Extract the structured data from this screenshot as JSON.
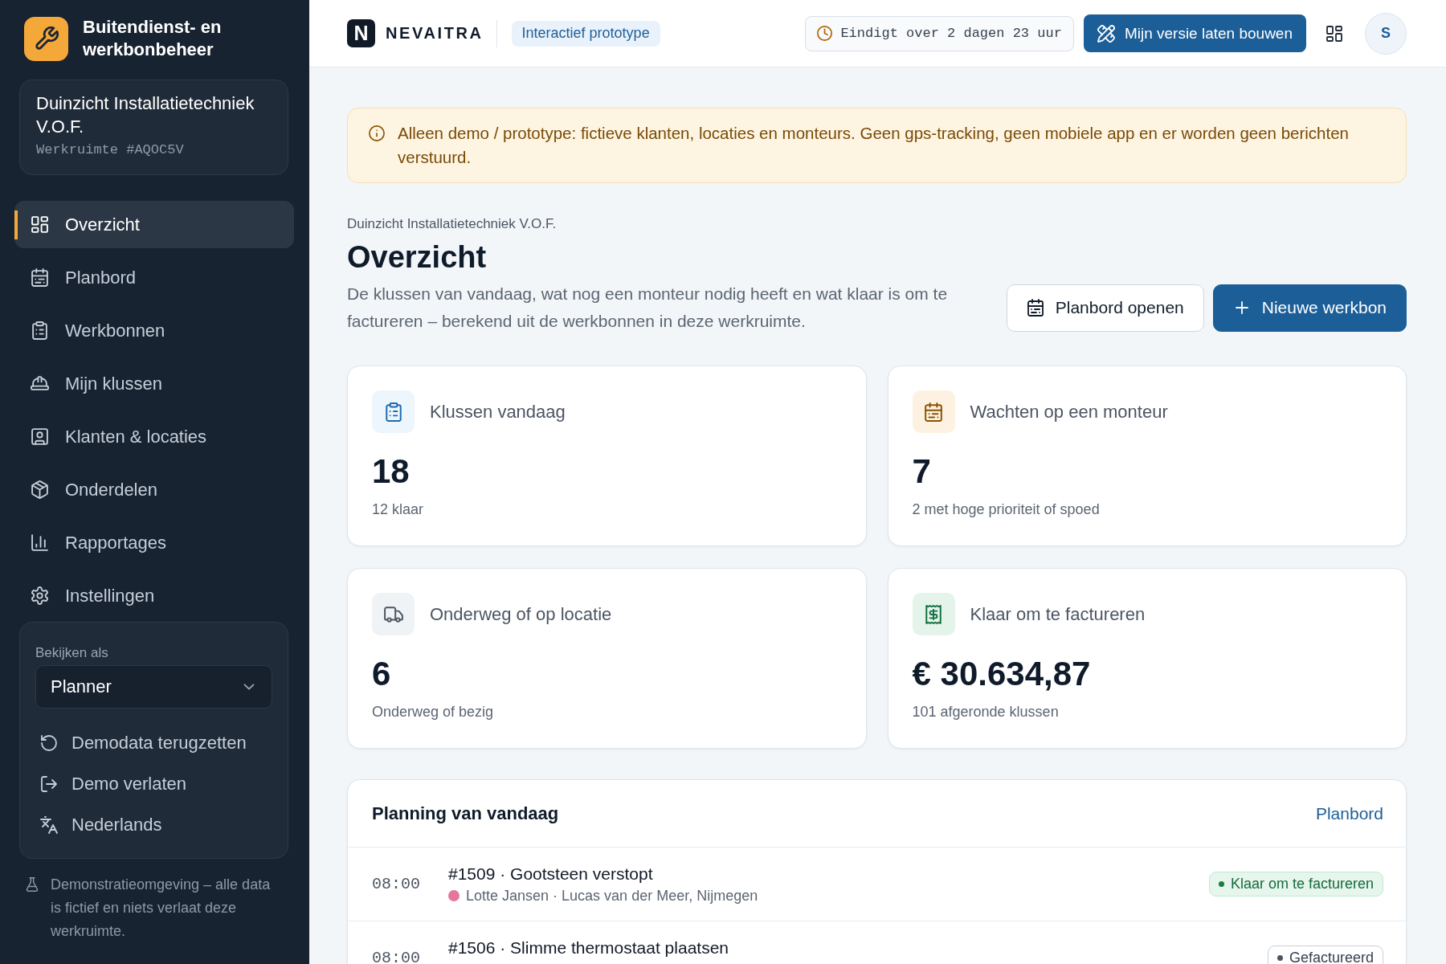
{
  "sidebar": {
    "app_title": "Buitendienst- en werkbonbeheer",
    "workspace": {
      "name": "Duinzicht Installatietechniek V.O.F.",
      "id_label": "Werkruimte #AQOC5V"
    },
    "nav": [
      {
        "label": "Overzicht",
        "kind": "overview",
        "selected": true
      },
      {
        "label": "Planbord",
        "kind": "planning",
        "selected": false
      },
      {
        "label": "Werkbonnen",
        "kind": "workorders",
        "selected": false
      },
      {
        "label": "Mijn klussen",
        "kind": "myjobs",
        "selected": false
      },
      {
        "label": "Klanten & locaties",
        "kind": "customers",
        "selected": false
      },
      {
        "label": "Onderdelen",
        "kind": "parts",
        "selected": false
      },
      {
        "label": "Rapportages",
        "kind": "reports",
        "selected": false
      },
      {
        "label": "Instellingen",
        "kind": "settings",
        "selected": false
      }
    ],
    "view_as": {
      "label": "Bekijken als",
      "value": "Planner"
    },
    "actions": [
      {
        "label": "Demodata terugzetten",
        "kind": "reset"
      },
      {
        "label": "Demo verlaten",
        "kind": "exit"
      },
      {
        "label": "Nederlands",
        "kind": "language"
      }
    ],
    "footer_note": "Demonstratieomgeving – alle data is fictief en niets verlaat deze werkruimte."
  },
  "header": {
    "brand": {
      "mark": "N",
      "name": "NEVAITRA"
    },
    "badge": "Interactief prototype",
    "countdown": "Eindigt over 2 dagen 23 uur",
    "build_button": "Mijn versie laten bouwen",
    "avatar": "S"
  },
  "alert": "Alleen demo / prototype: fictieve klanten, locaties en monteurs. Geen gps-tracking, geen mobiele app en er worden geen berichten verstuurd.",
  "page": {
    "breadcrumb": "Duinzicht Installatietechniek V.O.F.",
    "title": "Overzicht",
    "description": "De klussen van vandaag, wat nog een monteur nodig heeft en wat klaar is om te factureren – berekend uit de werkbonnen in deze werkruimte.",
    "buttons": [
      {
        "label": "Planbord openen",
        "kind": "secondary"
      },
      {
        "label": "Nieuwe werkbon",
        "kind": "primary"
      }
    ]
  },
  "stats": [
    {
      "kind": "jobs",
      "label": "Klussen vandaag",
      "value": "18",
      "note": "12 klaar"
    },
    {
      "kind": "waiting",
      "label": "Wachten op een monteur",
      "value": "7",
      "note": "2 met hoge prioriteit of spoed"
    },
    {
      "kind": "onroute",
      "label": "Onderweg of op locatie",
      "value": "6",
      "note": "Onderweg of bezig"
    },
    {
      "kind": "billing",
      "label": "Klaar om te factureren",
      "value": "€ 30.634,87",
      "note": "101 afgeronde klussen"
    }
  ],
  "planning": {
    "title": "Planning van vandaag",
    "link": "Planbord",
    "rows": [
      {
        "time": "08:00",
        "title": "#1509 · Gootsteen verstopt",
        "color": "#e5779d",
        "details": "Lotte Jansen · Lucas van der Meer, Nijmegen",
        "status": {
          "label": "Klaar om te factureren",
          "kind": "ready"
        }
      },
      {
        "time": "08:00",
        "title": "#1506 · Slimme thermostaat plaatsen",
        "status": {
          "label": "Gefactureerd",
          "kind": "invoiced"
        }
      }
    ]
  }
}
